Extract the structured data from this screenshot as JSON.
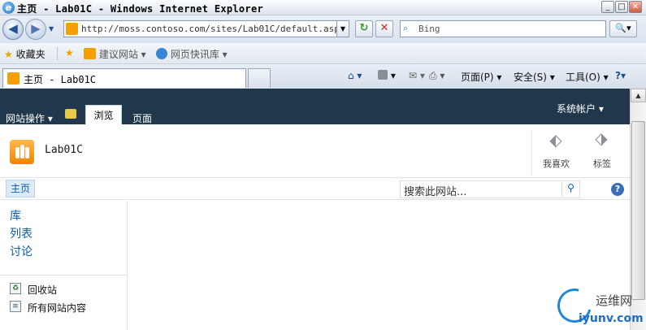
{
  "window": {
    "title": "主页 - Lab01C - Windows Internet Explorer",
    "minimize": "_",
    "maximize": "□",
    "close": "✕"
  },
  "addressbar": {
    "back": "◀",
    "forward": "▶",
    "url": "http://moss.contoso.com/sites/Lab01C/default.aspx",
    "refresh": "↻",
    "stop": "✕",
    "search_placeholder": "Bing",
    "search_button": "🔍▾"
  },
  "favorites_bar": {
    "favorites": "收藏夹",
    "suggested_sites": "建议网站 ▾",
    "web_slice_gallery": "网页快讯库 ▾"
  },
  "tabs": {
    "active_tab": "主页 - Lab01C"
  },
  "command_bar": {
    "home": "⌂ ▾",
    "feeds": "▾",
    "mail": "✉ ▾",
    "print": "⎙ ▾",
    "page": "页面(P) ▾",
    "safety": "安全(S) ▾",
    "tools": "工具(O) ▾",
    "help": "?▾"
  },
  "ribbon": {
    "site_actions": "网站操作 ▾",
    "tab_browse": "浏览",
    "tab_page": "页面",
    "user_menu": "系统帐户 ▾",
    "site_title": "Lab01C",
    "i_like_it": "我喜欢",
    "tags": "标签"
  },
  "topnav": {
    "home": "主页",
    "search_placeholder": "搜索此网站..."
  },
  "leftnav": {
    "libraries": "库",
    "lists": "列表",
    "discussions": "讨论",
    "recycle_bin": "回收站",
    "all_site_content": "所有网站内容"
  },
  "watermark": {
    "top": "运维网",
    "bottom": "iyunv.com"
  }
}
